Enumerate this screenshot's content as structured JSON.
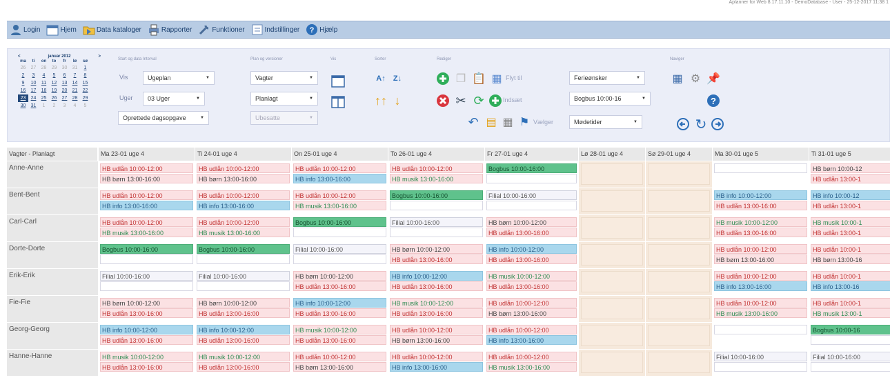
{
  "status_text": "Aplanner for Web 8.17.11.10 - DemoDatabase - User - 25-12-2017 11:38 1",
  "menu": [
    {
      "label": "Login",
      "icon": "user-icon"
    },
    {
      "label": "Hjem",
      "icon": "calendar-home-icon"
    },
    {
      "label": "Data kataloger",
      "icon": "folder-icon"
    },
    {
      "label": "Rapporter",
      "icon": "printer-icon"
    },
    {
      "label": "Funktioner",
      "icon": "wrench-icon"
    },
    {
      "label": "Indstillinger",
      "icon": "settings-icon"
    },
    {
      "label": "Hjælp",
      "icon": "help-icon"
    }
  ],
  "calendar": {
    "prev": "<",
    "month": "januar 2012",
    "next": ">",
    "weekdays": [
      "ma",
      "ti",
      "on",
      "to",
      "fr",
      "lø",
      "sø"
    ],
    "weeks": [
      [
        "26",
        "27",
        "28",
        "29",
        "30",
        "31",
        "1"
      ],
      [
        "2",
        "3",
        "4",
        "5",
        "6",
        "7",
        "8"
      ],
      [
        "9",
        "10",
        "11",
        "12",
        "13",
        "14",
        "15"
      ],
      [
        "16",
        "17",
        "18",
        "19",
        "20",
        "21",
        "22"
      ],
      [
        "23",
        "24",
        "25",
        "26",
        "27",
        "28",
        "29"
      ],
      [
        "30",
        "31",
        "1",
        "2",
        "3",
        "4",
        "5"
      ]
    ]
  },
  "groups": {
    "start": "Start og data Interval",
    "plan": "Plan og versioner",
    "vis": "Vis",
    "sort": "Sorter",
    "edit": "Rediger",
    "nav": "Naviger"
  },
  "controls": {
    "vis_label": "Vis",
    "vis_value": "Ugeplan",
    "uger_label": "Uger",
    "uger_value": "03 Uger",
    "opg_value": "Oprettede dagsopgave",
    "vagter_value": "Vagter",
    "planlagt_value": "Planlagt",
    "ubesatte_value": "Ubesatte",
    "flyt_label": "Flyt til",
    "indsaet_label": "Indsæt",
    "vaelger_label": "Vælger",
    "ferie_value": "Ferieønsker",
    "bogbus_value": "Bogbus 10:00-16",
    "modetider_value": "Mødetider"
  },
  "grid": {
    "corner": "Vagter - Planlagt",
    "days": [
      {
        "label": "Ma 23-01 uge 4",
        "weekend": false
      },
      {
        "label": "Ti 24-01 uge 4",
        "weekend": false
      },
      {
        "label": "On 25-01 uge 4",
        "weekend": false
      },
      {
        "label": "To 26-01 uge 4",
        "weekend": false
      },
      {
        "label": "Fr 27-01 uge 4",
        "weekend": false
      },
      {
        "label": "Lø 28-01 uge 4",
        "weekend": true
      },
      {
        "label": "Sø 29-01 uge 4",
        "weekend": true
      },
      {
        "label": "Ma 30-01 uge 5",
        "weekend": false
      },
      {
        "label": "Ti 31-01 uge 5",
        "weekend": false
      }
    ],
    "rows": [
      {
        "name": "Anne-Anne",
        "cells": [
          [
            [
              "u",
              "HB udlån 10:00-12:00"
            ],
            [
              "b",
              "HB børn 13:00-16:00"
            ]
          ],
          [
            [
              "u",
              "HB udlån 10:00-12:00"
            ],
            [
              "b",
              "HB børn 13:00-16:00"
            ]
          ],
          [
            [
              "u",
              "HB udlån 10:00-12:00"
            ],
            [
              "i",
              "HB info 13:00-16:00"
            ]
          ],
          [
            [
              "u",
              "HB udlån 10:00-12:00"
            ],
            [
              "m",
              "HB musik 13:00-16:00"
            ]
          ],
          [
            [
              "g",
              "Bogbus 10:00-16:00"
            ],
            [
              "e",
              ""
            ]
          ],
          [],
          [],
          [
            [
              "e",
              ""
            ]
          ],
          [
            [
              "b",
              "HB børn 10:00-12"
            ],
            [
              "u",
              "HB udlån 13:00-1"
            ]
          ]
        ]
      },
      {
        "name": "Bent-Bent",
        "cells": [
          [
            [
              "u",
              "HB udlån 10:00-12:00"
            ],
            [
              "i",
              "HB info 13:00-16:00"
            ]
          ],
          [
            [
              "u",
              "HB udlån 10:00-12:00"
            ],
            [
              "i",
              "HB info 13:00-16:00"
            ]
          ],
          [
            [
              "u",
              "HB udlån 10:00-12:00"
            ],
            [
              "m",
              "HB musik 13:00-16:00"
            ]
          ],
          [
            [
              "g",
              "Bogbus 10:00-16:00"
            ],
            [
              "e",
              ""
            ]
          ],
          [
            [
              "f",
              "Filial 10:00-16:00"
            ],
            [
              "e",
              ""
            ]
          ],
          [],
          [],
          [
            [
              "i",
              "HB info 10:00-12:00"
            ],
            [
              "u",
              "HB udlån 13:00-16:00"
            ]
          ],
          [
            [
              "i",
              "HB info 10:00-12"
            ],
            [
              "u",
              "HB udlån 13:00-1"
            ]
          ]
        ]
      },
      {
        "name": "Carl-Carl",
        "cells": [
          [
            [
              "u",
              "HB udlån 10:00-12:00"
            ],
            [
              "m",
              "HB musik 13:00-16:00"
            ]
          ],
          [
            [
              "u",
              "HB udlån 10:00-12:00"
            ],
            [
              "m",
              "HB musik 13:00-16:00"
            ]
          ],
          [
            [
              "g",
              "Bogbus 10:00-16:00"
            ],
            [
              "e",
              ""
            ]
          ],
          [
            [
              "f",
              "Filial 10:00-16:00"
            ],
            [
              "e",
              ""
            ]
          ],
          [
            [
              "b",
              "HB børn 10:00-12:00"
            ],
            [
              "u",
              "HB udlån 13:00-16:00"
            ]
          ],
          [],
          [],
          [
            [
              "m",
              "HB musik 10:00-12:00"
            ],
            [
              "u",
              "HB udlån 13:00-16:00"
            ]
          ],
          [
            [
              "m",
              "HB musik 10:00-1"
            ],
            [
              "u",
              "HB udlån 13:00-1"
            ]
          ]
        ]
      },
      {
        "name": "Dorte-Dorte",
        "cells": [
          [
            [
              "g",
              "Bogbus 10:00-16:00"
            ],
            [
              "e",
              ""
            ]
          ],
          [
            [
              "g",
              "Bogbus 10:00-16:00"
            ],
            [
              "e",
              ""
            ]
          ],
          [
            [
              "f",
              "Filial 10:00-16:00"
            ],
            [
              "e",
              ""
            ]
          ],
          [
            [
              "b",
              "HB børn 10:00-12:00"
            ],
            [
              "u",
              "HB udlån 13:00-16:00"
            ]
          ],
          [
            [
              "i",
              "HB info 10:00-12:00"
            ],
            [
              "u",
              "HB udlån 13:00-16:00"
            ]
          ],
          [],
          [],
          [
            [
              "u",
              "HB udlån 10:00-12:00"
            ],
            [
              "b",
              "HB børn 13:00-16:00"
            ]
          ],
          [
            [
              "u",
              "HB udlån 10:00-1"
            ],
            [
              "b",
              "HB børn 13:00-16"
            ]
          ]
        ]
      },
      {
        "name": "Erik-Erik",
        "cells": [
          [
            [
              "f",
              "Filial 10:00-16:00"
            ],
            [
              "e",
              ""
            ]
          ],
          [
            [
              "f",
              "Filial 10:00-16:00"
            ],
            [
              "e",
              ""
            ]
          ],
          [
            [
              "b",
              "HB børn 10:00-12:00"
            ],
            [
              "u",
              "HB udlån 13:00-16:00"
            ]
          ],
          [
            [
              "i",
              "HB info 10:00-12:00"
            ],
            [
              "u",
              "HB udlån 13:00-16:00"
            ]
          ],
          [
            [
              "m",
              "HB musik 10:00-12:00"
            ],
            [
              "u",
              "HB udlån 13:00-16:00"
            ]
          ],
          [],
          [],
          [
            [
              "u",
              "HB udlån 10:00-12:00"
            ],
            [
              "i",
              "HB info 13:00-16:00"
            ]
          ],
          [
            [
              "u",
              "HB udlån 10:00-1"
            ],
            [
              "i",
              "HB info 13:00-16"
            ]
          ]
        ]
      },
      {
        "name": "Fie-Fie",
        "cells": [
          [
            [
              "b",
              "HB børn 10:00-12:00"
            ],
            [
              "u",
              "HB udlån 13:00-16:00"
            ]
          ],
          [
            [
              "b",
              "HB børn 10:00-12:00"
            ],
            [
              "u",
              "HB udlån 13:00-16:00"
            ]
          ],
          [
            [
              "i",
              "HB info 10:00-12:00"
            ],
            [
              "u",
              "HB udlån 13:00-16:00"
            ]
          ],
          [
            [
              "m",
              "HB musik 10:00-12:00"
            ],
            [
              "u",
              "HB udlån 13:00-16:00"
            ]
          ],
          [
            [
              "u",
              "HB udlån 10:00-12:00"
            ],
            [
              "b",
              "HB børn 13:00-16:00"
            ]
          ],
          [],
          [],
          [
            [
              "u",
              "HB udlån 10:00-12:00"
            ],
            [
              "m",
              "HB musik 13:00-16:00"
            ]
          ],
          [
            [
              "u",
              "HB udlån 10:00-1"
            ],
            [
              "m",
              "HB musik 13:00-1"
            ]
          ]
        ]
      },
      {
        "name": "Georg-Georg",
        "cells": [
          [
            [
              "i",
              "HB info 10:00-12:00"
            ],
            [
              "u",
              "HB udlån 13:00-16:00"
            ]
          ],
          [
            [
              "i",
              "HB info 10:00-12:00"
            ],
            [
              "u",
              "HB udlån 13:00-16:00"
            ]
          ],
          [
            [
              "m",
              "HB musik 10:00-12:00"
            ],
            [
              "u",
              "HB udlån 13:00-16:00"
            ]
          ],
          [
            [
              "u",
              "HB udlån 10:00-12:00"
            ],
            [
              "b",
              "HB børn 13:00-16:00"
            ]
          ],
          [
            [
              "u",
              "HB udlån 10:00-12:00"
            ],
            [
              "i",
              "HB info 13:00-16:00"
            ]
          ],
          [],
          [],
          [
            [
              "e",
              ""
            ]
          ],
          [
            [
              "g",
              "Bogbus 10:00-16"
            ],
            [
              "e",
              ""
            ]
          ]
        ]
      },
      {
        "name": "Hanne-Hanne",
        "cells": [
          [
            [
              "m",
              "HB musik 10:00-12:00"
            ],
            [
              "u",
              "HB udlån 13:00-16:00"
            ]
          ],
          [
            [
              "m",
              "HB musik 10:00-12:00"
            ],
            [
              "u",
              "HB udlån 13:00-16:00"
            ]
          ],
          [
            [
              "u",
              "HB udlån 10:00-12:00"
            ],
            [
              "b",
              "HB børn 13:00-16:00"
            ]
          ],
          [
            [
              "u",
              "HB udlån 10:00-12:00"
            ],
            [
              "i",
              "HB info 13:00-16:00"
            ]
          ],
          [
            [
              "u",
              "HB udlån 10:00-12:00"
            ],
            [
              "m",
              "HB musik 13:00-16:00"
            ]
          ],
          [],
          [],
          [
            [
              "f",
              "Filial 10:00-16:00"
            ],
            [
              "e",
              ""
            ]
          ],
          [
            [
              "f",
              "Filial 10:00-16:00"
            ],
            [
              "e",
              ""
            ]
          ]
        ]
      }
    ]
  }
}
